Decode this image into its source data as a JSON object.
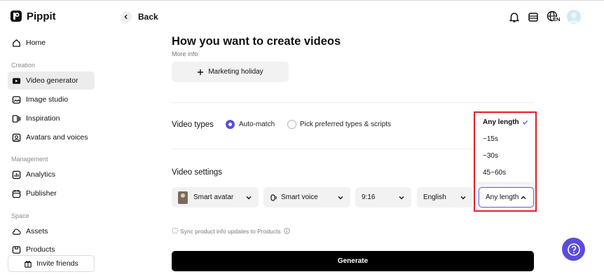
{
  "app": {
    "name": "Pippit"
  },
  "sidebar": {
    "items_top": [
      {
        "label": "Home"
      }
    ],
    "sections": [
      {
        "title": "Creation",
        "items": [
          {
            "label": "Video generator",
            "active": true
          },
          {
            "label": "Image studio"
          },
          {
            "label": "Inspiration"
          },
          {
            "label": "Avatars and voices"
          }
        ]
      },
      {
        "title": "Management",
        "items": [
          {
            "label": "Analytics"
          },
          {
            "label": "Publisher"
          }
        ]
      },
      {
        "title": "Space",
        "items": [
          {
            "label": "Assets"
          },
          {
            "label": "Products"
          }
        ]
      }
    ],
    "invite_label": "Invite friends"
  },
  "header": {
    "back_label": "Back",
    "language_badge": "EN"
  },
  "main": {
    "title": "How you want to create videos",
    "more_info_label": "More info",
    "holiday_button": "Marketing holiday",
    "video_types": {
      "label": "Video types",
      "options": [
        {
          "label": "Auto-match",
          "selected": true
        },
        {
          "label": "Pick preferred types & scripts",
          "selected": false
        }
      ]
    },
    "video_settings": {
      "label": "Video settings",
      "avatar": "Smart avatar",
      "voice": "Smart voice",
      "aspect_ratio": "9:16",
      "language": "English",
      "length": "Any length"
    },
    "sync_label": "Sync product info updates to Products",
    "generate_label": "Generate"
  },
  "length_dropdown": {
    "options": [
      {
        "label": "Any length",
        "selected": true
      },
      {
        "label": "~15s"
      },
      {
        "label": "~30s"
      },
      {
        "label": "45~60s"
      }
    ]
  },
  "colors": {
    "accent": "#5b4cdb",
    "highlight": "#e0202a",
    "generate_bg": "#000000"
  }
}
